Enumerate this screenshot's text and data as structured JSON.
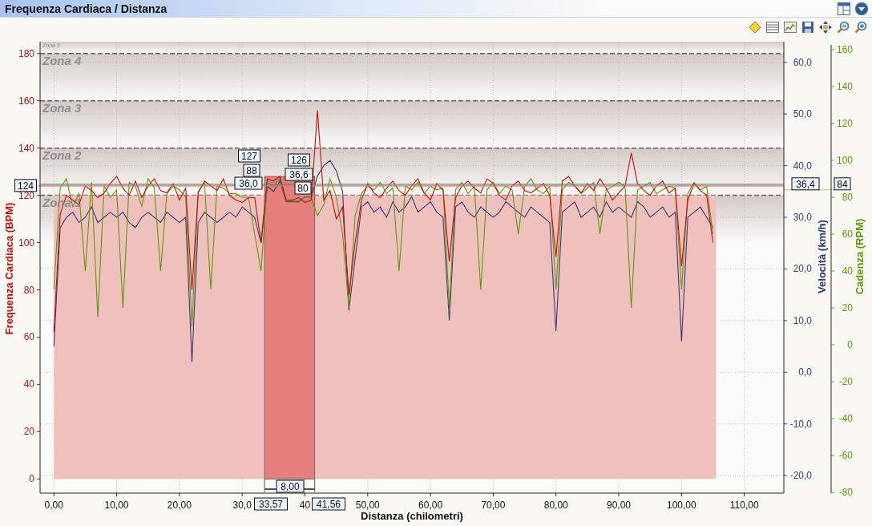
{
  "header": {
    "title": "Frequenza Cardiaca / Distanza"
  },
  "chart": {
    "chart_data": {
      "type": "line",
      "xlabel": "Distanza (chilometri)",
      "grid": true,
      "x": [
        0,
        1,
        2,
        3,
        4,
        5,
        6,
        7,
        8,
        9,
        10,
        11,
        12,
        13,
        14,
        15,
        16,
        17,
        18,
        19,
        20,
        21,
        22,
        23,
        24,
        25,
        26,
        27,
        28,
        29,
        30,
        31,
        32,
        33,
        34,
        35,
        36,
        37,
        38,
        39,
        40,
        41,
        42,
        43,
        44,
        45,
        46,
        47,
        48,
        49,
        50,
        51,
        52,
        53,
        54,
        55,
        56,
        57,
        58,
        59,
        60,
        61,
        62,
        63,
        64,
        65,
        66,
        67,
        68,
        69,
        70,
        71,
        72,
        73,
        74,
        75,
        76,
        77,
        78,
        79,
        80,
        81,
        82,
        83,
        84,
        85,
        86,
        87,
        88,
        89,
        90,
        91,
        92,
        93,
        94,
        95,
        96,
        97,
        98,
        99,
        100,
        101,
        102,
        103,
        104,
        105
      ],
      "xlim": [
        -2.2,
        116.3
      ],
      "ylim": [
        -6,
        185
      ],
      "xticks": [
        {
          "value": 0,
          "label": "0,00"
        },
        {
          "value": 10,
          "label": "10,00"
        },
        {
          "value": 20,
          "label": "20,00"
        },
        {
          "value": 30,
          "label": "30,0"
        },
        {
          "value": 40,
          "label": "40"
        },
        {
          "value": 50,
          "label": "50,00"
        },
        {
          "value": 60,
          "label": "60,00"
        },
        {
          "value": 70,
          "label": "70,00"
        },
        {
          "value": 80,
          "label": "80,00"
        },
        {
          "value": 90,
          "label": "90,00"
        },
        {
          "value": 100,
          "label": "100,00"
        },
        {
          "value": 110,
          "label": "110,00"
        }
      ],
      "yticks": [
        180,
        160,
        140,
        120,
        100,
        80,
        60,
        40,
        20,
        0
      ],
      "y2lim": [
        -23.4,
        64.0
      ],
      "y2ticks": [
        {
          "value": 60,
          "label": "60,0"
        },
        {
          "value": 50,
          "label": "50,0"
        },
        {
          "value": 40,
          "label": "40,0"
        },
        {
          "value": 30,
          "label": "30,0"
        },
        {
          "value": 20,
          "label": "20,0"
        },
        {
          "value": 10,
          "label": "10,0"
        },
        {
          "value": 0,
          "label": "0,0"
        },
        {
          "value": -10,
          "label": "-10,0"
        },
        {
          "value": -20,
          "label": "-20,0"
        }
      ],
      "y3lim": [
        -80.4,
        164.3
      ],
      "y3ticks": [
        160,
        140,
        120,
        100,
        80,
        60,
        40,
        20,
        0,
        -20,
        -40,
        -60,
        -80
      ],
      "bands": [
        {
          "axis": "y",
          "from": 180,
          "to": 185,
          "label": "Zona 5"
        },
        {
          "axis": "y",
          "from": 160,
          "to": 180,
          "label": "Zona 4"
        },
        {
          "axis": "y",
          "from": 140,
          "to": 160,
          "label": "Zona 3"
        },
        {
          "axis": "y",
          "from": 120,
          "to": 140,
          "label": "Zona 2"
        },
        {
          "axis": "y",
          "from": 100,
          "to": 120,
          "label": "Zona 1"
        },
        {
          "axis": "x",
          "from": 33.57,
          "to": 41.56,
          "color": "#e67e7c"
        }
      ],
      "ref_lines": [
        {
          "axis": "y",
          "value": 124,
          "label": "124",
          "color": "#e07070"
        },
        {
          "axis": "y2",
          "value": 36.4,
          "label": "36,4",
          "color": "#5e8a70"
        },
        {
          "axis": "y3",
          "value": 84,
          "label": "84",
          "color": "#a8d080"
        }
      ],
      "series": [
        {
          "name": "Frequenza Cardiaca (BPM)",
          "color": "#cc0a0a",
          "values": [
            62,
            112,
            120,
            118,
            116,
            124,
            122,
            119,
            121,
            125,
            128,
            123,
            120,
            126,
            119,
            124,
            127,
            122,
            121,
            125,
            118,
            123,
            80,
            121,
            126,
            124,
            122,
            127,
            120,
            118,
            117,
            119,
            119,
            100,
            127,
            126,
            128,
            118,
            118,
            119,
            117,
            118,
            156,
            118,
            122,
            110,
            115,
            78,
            100,
            118,
            125,
            121,
            119,
            123,
            126,
            122,
            120,
            124,
            127,
            121,
            118,
            125,
            122,
            92,
            119,
            124,
            126,
            123,
            121,
            127,
            125,
            120,
            118,
            124,
            126,
            122,
            121,
            123,
            125,
            120,
            94,
            126,
            128,
            124,
            121,
            125,
            122,
            127,
            123,
            118,
            121,
            124,
            138,
            125,
            122,
            120,
            124,
            126,
            121,
            123,
            90,
            118,
            125,
            122,
            120,
            100
          ]
        },
        {
          "name": "Velocità (km/h)",
          "axis": "y2",
          "color": "#3a3a7a",
          "values": [
            5,
            28,
            30,
            31,
            29,
            30,
            32,
            29,
            30,
            31,
            30,
            31,
            29,
            28,
            30,
            31,
            30,
            29,
            31,
            30,
            29,
            30,
            2,
            29,
            31,
            30,
            29,
            30,
            31,
            30,
            32,
            31,
            30,
            25,
            36,
            35,
            37,
            33,
            33,
            33,
            34,
            34,
            38,
            40,
            41,
            39,
            35,
            12,
            22,
            32,
            33,
            31,
            32,
            30,
            33,
            31,
            32,
            34,
            31,
            32,
            33,
            31,
            30,
            10,
            32,
            33,
            31,
            30,
            32,
            31,
            30,
            31,
            33,
            32,
            31,
            30,
            32,
            31,
            30,
            29,
            8,
            31,
            32,
            33,
            30,
            31,
            32,
            30,
            33,
            31,
            32,
            31,
            30,
            33,
            32,
            30,
            31,
            32,
            30,
            31,
            6,
            30,
            31,
            32,
            30,
            28
          ]
        },
        {
          "name": "Cadenza (RPM)",
          "axis": "y3",
          "color": "#5c9a08",
          "values": [
            30,
            85,
            90,
            75,
            82,
            40,
            88,
            15,
            86,
            80,
            84,
            20,
            88,
            86,
            75,
            90,
            85,
            40,
            82,
            86,
            84,
            80,
            10,
            83,
            88,
            30,
            86,
            85,
            82,
            82,
            80,
            80,
            60,
            40,
            88,
            86,
            90,
            78,
            78,
            78,
            80,
            80,
            70,
            76,
            90,
            80,
            60,
            20,
            70,
            82,
            86,
            84,
            88,
            82,
            85,
            40,
            86,
            84,
            88,
            82,
            86,
            84,
            85,
            20,
            84,
            88,
            82,
            86,
            30,
            84,
            88,
            82,
            86,
            84,
            60,
            86,
            90,
            84,
            82,
            86,
            30,
            84,
            88,
            86,
            82,
            85,
            88,
            60,
            84,
            86,
            88,
            86,
            20,
            84,
            86,
            88,
            82,
            84,
            86,
            85,
            30,
            82,
            88,
            84,
            86,
            60
          ]
        }
      ]
    },
    "cursor_start": {
      "heart_rate": "127",
      "cadence": "88",
      "speed": "36,0"
    },
    "cursor_end": {
      "heart_rate": "126",
      "speed": "36,6",
      "cadence": "80"
    },
    "selection": {
      "start": "33,57",
      "end": "41,56",
      "length": "8,00"
    }
  }
}
